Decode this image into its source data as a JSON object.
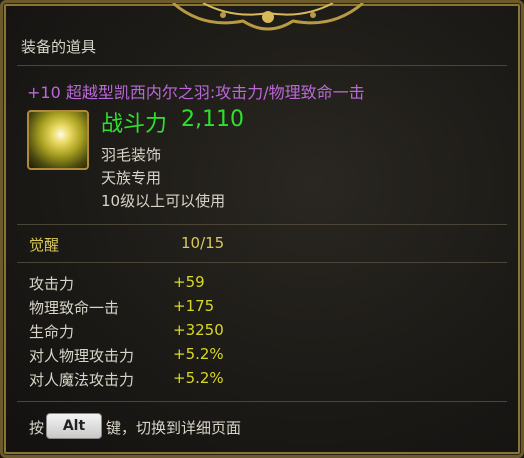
{
  "header": {
    "title": "装备的道具"
  },
  "item": {
    "name": "+10 超越型凯西内尔之羽:攻击力/物理致命一击",
    "icon": "feather-icon",
    "power_label": "战斗力",
    "power_value": "2,110",
    "type": "羽毛装饰",
    "race": "天族专用",
    "level_req": "10级以上可以使用"
  },
  "awaken": {
    "label": "觉醒",
    "value": "10/15"
  },
  "stats": [
    {
      "label": "攻击力",
      "value": "+59"
    },
    {
      "label": "物理致命一击",
      "value": "+175"
    },
    {
      "label": "生命力",
      "value": "+3250"
    },
    {
      "label": "对人物理攻击力",
      "value": "+5.2%"
    },
    {
      "label": "对人魔法攻击力",
      "value": "+5.2%"
    }
  ],
  "hint": {
    "prefix": "按",
    "key": "Alt",
    "suffix": "键，切换到详细页面"
  },
  "colors": {
    "title": "#b968d8",
    "power": "#2ee02e",
    "stat_value": "#d8d828",
    "border": "#8a7434"
  }
}
